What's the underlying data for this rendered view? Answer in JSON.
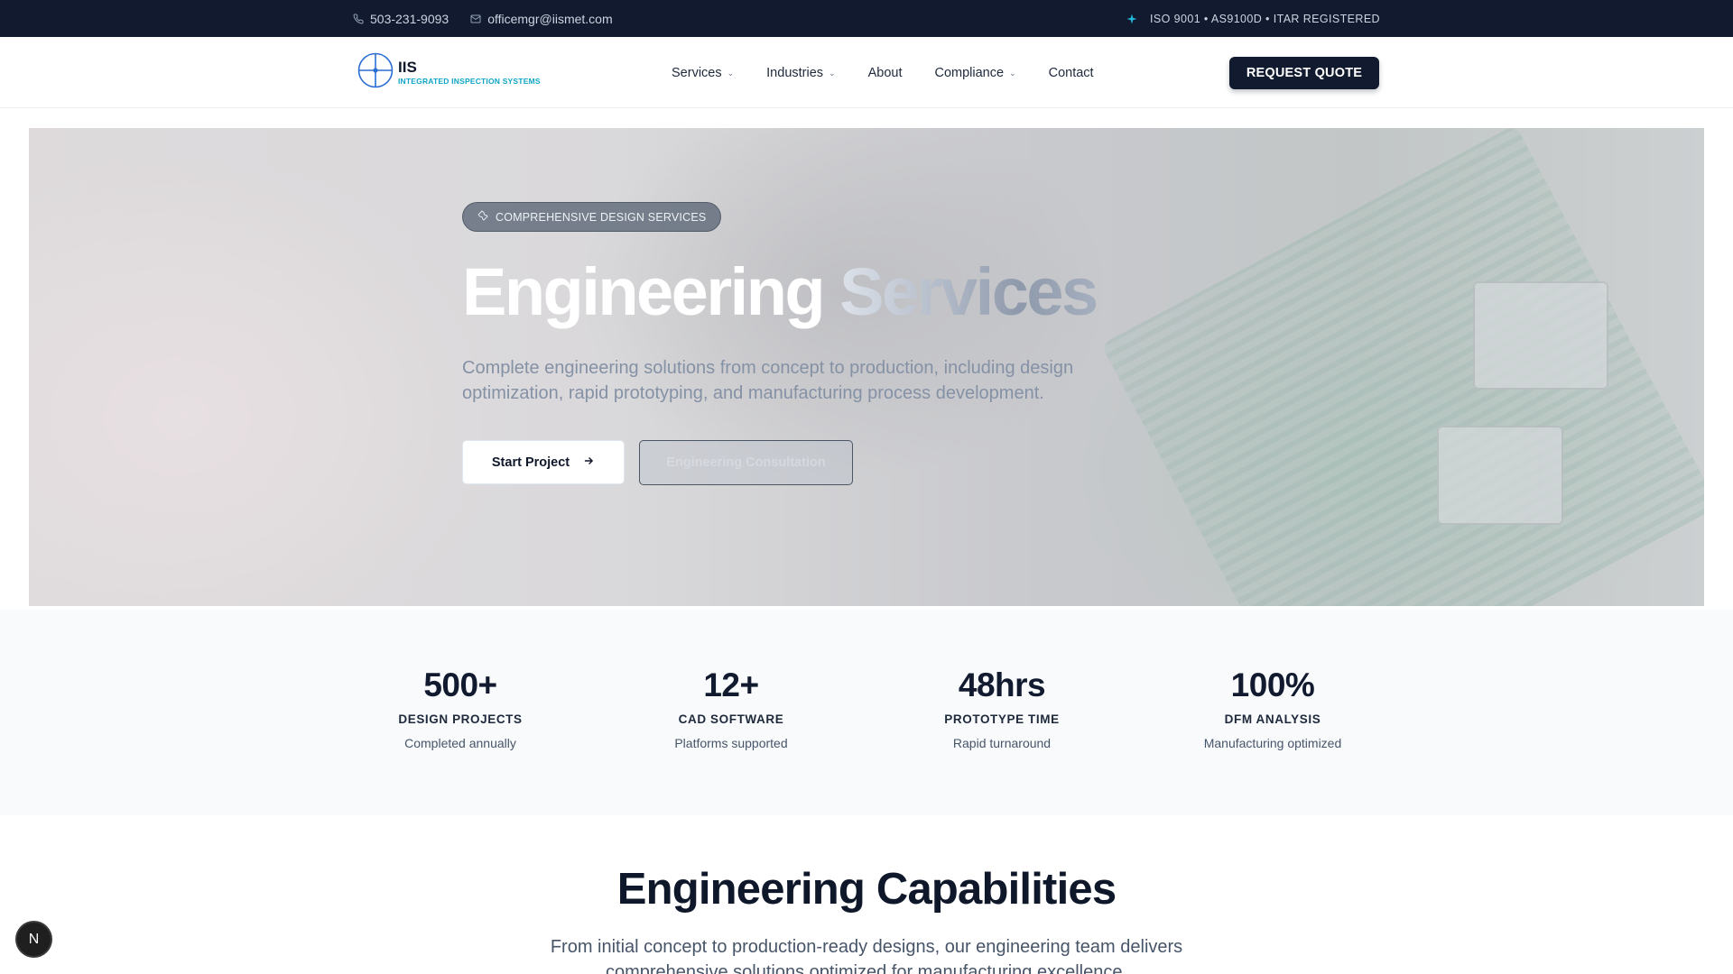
{
  "topbar": {
    "phone": "503-231-9093",
    "email": "officemgr@iismet.com",
    "certifications": "ISO 9001 • AS9100D • ITAR REGISTERED"
  },
  "header": {
    "logo_name": "IIS",
    "logo_subtitle": "INTEGRATED INSPECTION SYSTEMS",
    "nav": {
      "services": "Services",
      "industries": "Industries",
      "about": "About",
      "compliance": "Compliance",
      "contact": "Contact"
    },
    "cta": "REQUEST QUOTE"
  },
  "hero": {
    "badge": "COMPREHENSIVE DESIGN SERVICES",
    "title_part1": "Engineering",
    "title_part2": "Services",
    "description": "Complete engineering solutions from concept to production, including design optimization, rapid prototyping, and manufacturing process development.",
    "primary_button": "Start Project",
    "secondary_button": "Engineering Consultation"
  },
  "stats": [
    {
      "value": "500+",
      "label": "DESIGN PROJECTS",
      "sub": "Completed annually"
    },
    {
      "value": "12+",
      "label": "CAD SOFTWARE",
      "sub": "Platforms supported"
    },
    {
      "value": "48hrs",
      "label": "PROTOTYPE TIME",
      "sub": "Rapid turnaround"
    },
    {
      "value": "100%",
      "label": "DFM ANALYSIS",
      "sub": "Manufacturing optimized"
    }
  ],
  "capabilities": {
    "title": "Engineering Capabilities",
    "description": "From initial concept to production-ready designs, our engineering team delivers comprehensive solutions optimized for manufacturing excellence."
  },
  "floating_button": "N",
  "icons": {
    "phone": "phone-icon",
    "email": "mail-icon",
    "cert": "sparkle-icon",
    "logo": "crosshair-logo-icon",
    "badge": "wrench-icon",
    "arrow": "arrow-right-icon"
  },
  "colors": {
    "navy": "#111a2e",
    "accent": "#0ea5c6"
  }
}
